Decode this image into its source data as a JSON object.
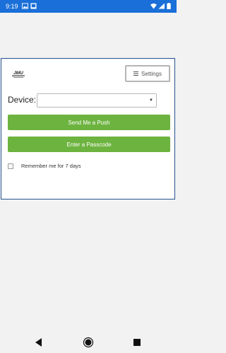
{
  "status_bar": {
    "time": "9:19"
  },
  "header": {
    "settings_label": "Settings"
  },
  "device": {
    "label": "Device:",
    "selected_value": ""
  },
  "actions": {
    "push_label": "Send Me a Push",
    "passcode_label": "Enter a Passcode"
  },
  "remember": {
    "label": "Remember me for 7 days",
    "checked": false
  },
  "colors": {
    "status_bar": "#1a6fd8",
    "action_green": "#6db33f",
    "card_border": "#24528f"
  }
}
